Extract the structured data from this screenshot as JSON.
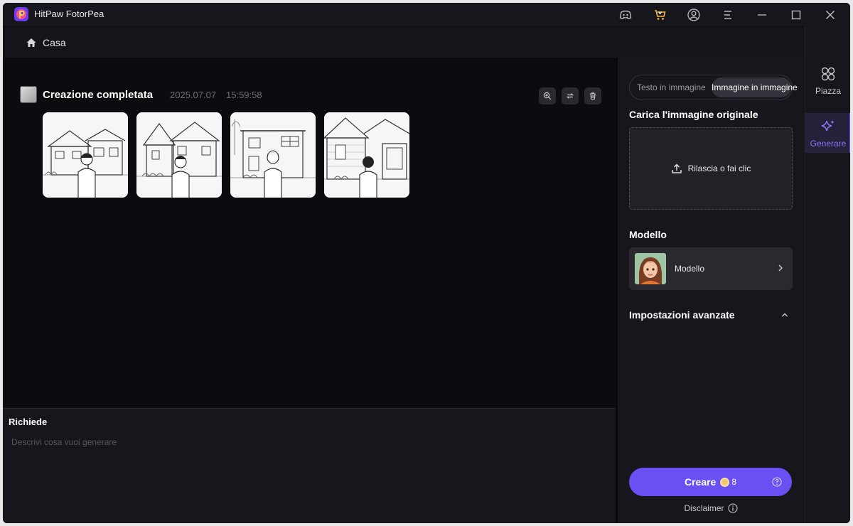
{
  "app": {
    "title": "HitPaw FotorPea"
  },
  "window_controls": [
    "discord-icon",
    "shop-icon",
    "account-icon",
    "menu-icon",
    "minimize-icon",
    "maximize-icon",
    "close-icon"
  ],
  "breadcrumb": {
    "label": "Casa"
  },
  "generation": {
    "title": "Creazione completata",
    "date": "2025.07.07",
    "time": "15:59:58",
    "tools": [
      "zoom-in-icon",
      "regenerate-icon",
      "delete-icon"
    ],
    "images": [
      "result-image-1",
      "result-image-2",
      "result-image-3",
      "result-image-4"
    ]
  },
  "prompt": {
    "title": "Richiede",
    "value": "",
    "placeholder": "Descrivi cosa vuoi generare"
  },
  "panel": {
    "mode_off": "Testo in immagine",
    "mode_on": "Immagine in immagine",
    "upload_title": "Carica l'immagine originale",
    "upload_label": "Rilascia o fai clic",
    "model_title": "Modello",
    "model_label": "Modello",
    "advanced_title": "Impostazioni avanzate",
    "create_label": "Creare",
    "create_cost": "8",
    "disclaimer": "Disclaimer"
  },
  "rail": {
    "piazza": "Piazza",
    "generate": "Generare"
  },
  "colors": {
    "accent": "#6a4ff2",
    "background": "#0c0b10",
    "panel": "#17161c"
  }
}
